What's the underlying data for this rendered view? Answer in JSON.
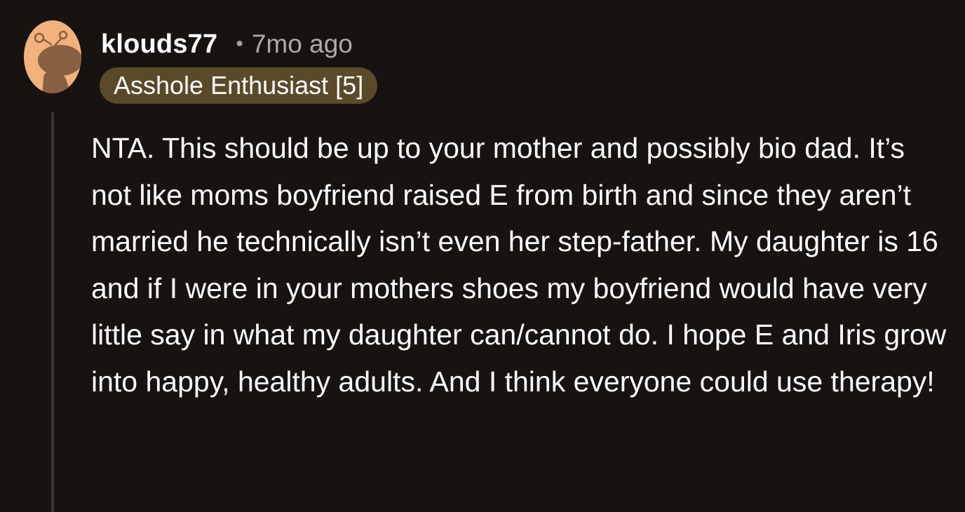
{
  "comment": {
    "author": "klouds77",
    "separator": "•",
    "timestamp": "7mo ago",
    "flair": "Asshole Enthusiast [5]",
    "body": "NTA. This should be up to your mother and possibly bio dad. It’s not like moms boyfriend raised E from birth and since they aren’t married he technically isn’t even her step-father. My daughter is 16 and if I were in your mothers shoes my boyfriend would have very little say in what my daughter can/cannot do. I hope E and Iris grow into happy, healthy adults. And I think everyone could use therapy!",
    "avatar_icon": "snoo-avatar-icon"
  },
  "colors": {
    "background": "#161311",
    "flair_background": "#5b4a2a",
    "avatar_skin": "#f2b27b",
    "avatar_shadow": "#8a6042",
    "thread_line": "#3a3632"
  }
}
